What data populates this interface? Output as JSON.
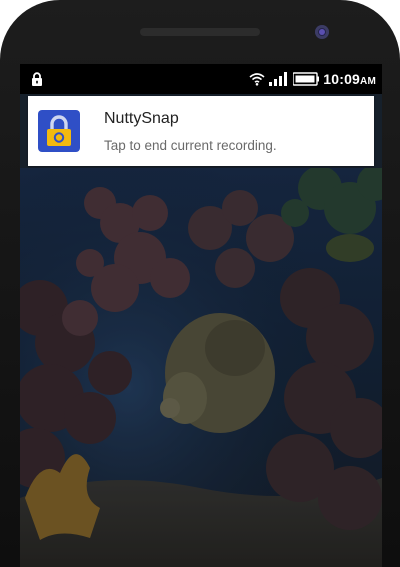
{
  "status_bar": {
    "time": "10:09",
    "ampm": "AM",
    "icons": [
      "lock-icon",
      "wifi-icon",
      "signal-icon",
      "battery-icon"
    ]
  },
  "notification": {
    "app_name": "NuttySnap",
    "text": "Tap to end current recording.",
    "icon": "padlock-icon"
  },
  "colors": {
    "app_icon_bg": "#2f4fc6",
    "lock_body": "#f2b90f"
  }
}
